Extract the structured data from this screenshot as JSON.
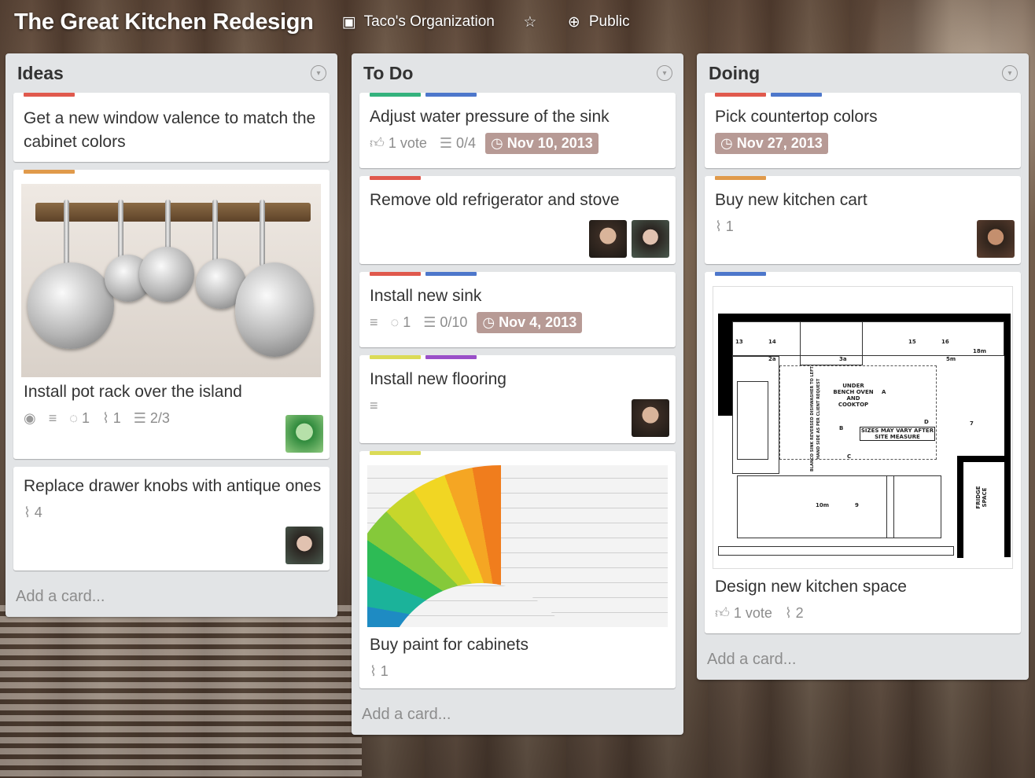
{
  "board": {
    "title": "The Great Kitchen Redesign",
    "organization": "Taco's Organization",
    "visibility": "Public"
  },
  "colors": {
    "green": "#34b27d",
    "blue": "#4d77cb",
    "red": "#e0594d",
    "orange": "#e09a4b",
    "yellow": "#dbdb57",
    "purple": "#9a4fc8",
    "due": "#b79a95"
  },
  "lists": [
    {
      "title": "Ideas",
      "add_card": "Add a card...",
      "cards": [
        {
          "labels": [
            "red"
          ],
          "title": "Get a new window valence to match the cabinet colors"
        },
        {
          "labels": [
            "orange"
          ],
          "image": "pot-rack",
          "title": "Install pot rack over the island",
          "comments": "1",
          "attachments": "1",
          "checklist": "2/3",
          "icons": [
            "eye-icon",
            "description-icon"
          ]
        },
        {
          "labels": [],
          "title": "Replace drawer knobs with antique ones",
          "attachments": "4"
        }
      ]
    },
    {
      "title": "To Do",
      "add_card": "Add a card...",
      "cards": [
        {
          "labels": [
            "green",
            "blue"
          ],
          "title": "Adjust water pressure of the sink",
          "votes": "1 vote",
          "checklist": "0/4",
          "due": "Nov 10, 2013"
        },
        {
          "labels": [
            "red"
          ],
          "title": "Remove old refrigerator and stove"
        },
        {
          "labels": [
            "red",
            "blue"
          ],
          "title": "Install new sink",
          "comments": "1",
          "checklist": "0/10",
          "due": "Nov 4, 2013"
        },
        {
          "labels": [
            "yellow",
            "purple"
          ],
          "title": "Install new flooring"
        },
        {
          "labels": [
            "yellow"
          ],
          "image": "paint-swatches",
          "title": "Buy paint for cabinets",
          "attachments": "1"
        }
      ]
    },
    {
      "title": "Doing",
      "add_card": "Add a card...",
      "cards": [
        {
          "labels": [
            "red",
            "blue"
          ],
          "title": "Pick countertop colors",
          "due": "Nov 27, 2013"
        },
        {
          "labels": [
            "orange"
          ],
          "title": "Buy new kitchen cart",
          "attachments": "1"
        },
        {
          "labels": [
            "blue"
          ],
          "image": "floor-plan",
          "title": "Design new kitchen space",
          "votes": "1 vote",
          "attachments": "2"
        }
      ]
    }
  ],
  "floor_plan": {
    "notes": [
      "UNDER BENCH OVEN AND COOKTOP",
      "SIZES MAY VARY AFTER SITE MEASURE",
      "FRIDGE SPACE",
      "BLANCO SINK REVERSED DISHWASHER TO LEFT HAND SIDE AS PER CLIENT REQUEST"
    ],
    "markers": [
      "A",
      "B",
      "C",
      "D"
    ],
    "dims": [
      "13",
      "14",
      "15",
      "16",
      "2a",
      "3a",
      "5m",
      "7",
      "9",
      "10m",
      "18m"
    ]
  }
}
